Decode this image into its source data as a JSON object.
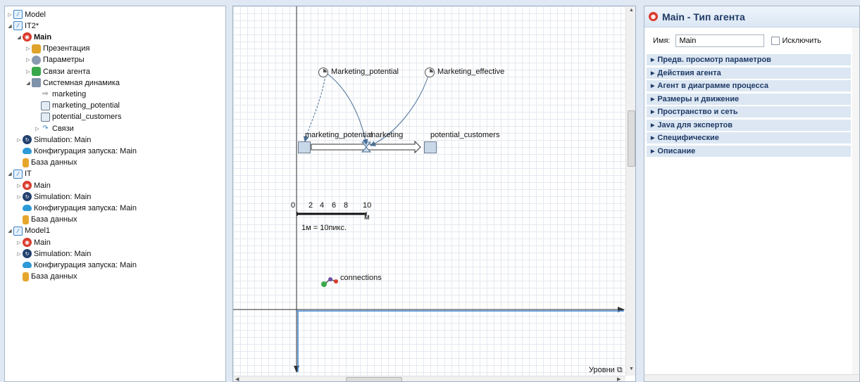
{
  "tree": [
    {
      "depth": 0,
      "arrow": "▷",
      "icon": "model",
      "label": "Model"
    },
    {
      "depth": 0,
      "arrow": "◢",
      "icon": "model",
      "label": "IT2*"
    },
    {
      "depth": 1,
      "arrow": "◢",
      "icon": "main",
      "label": "Main",
      "bold": true
    },
    {
      "depth": 2,
      "arrow": "▷",
      "icon": "pres",
      "label": "Презентация"
    },
    {
      "depth": 2,
      "arrow": "▷",
      "icon": "param",
      "label": "Параметры"
    },
    {
      "depth": 2,
      "arrow": "▷",
      "icon": "links",
      "label": "Связи агента"
    },
    {
      "depth": 2,
      "arrow": "◢",
      "icon": "sd",
      "label": "Системная динамика"
    },
    {
      "depth": 3,
      "arrow": "",
      "icon": "flow",
      "label": "marketing"
    },
    {
      "depth": 3,
      "arrow": "",
      "icon": "stock",
      "label": "marketing_potential"
    },
    {
      "depth": 3,
      "arrow": "",
      "icon": "stock",
      "label": "potential_customers"
    },
    {
      "depth": 3,
      "arrow": "▷",
      "icon": "conn",
      "label": "Связи"
    },
    {
      "depth": 1,
      "arrow": "▷",
      "icon": "sim",
      "label": "Simulation: Main"
    },
    {
      "depth": 1,
      "arrow": "",
      "icon": "cloud",
      "label": "Конфигурация запуска: Main"
    },
    {
      "depth": 1,
      "arrow": "",
      "icon": "db",
      "label": "База данных"
    },
    {
      "depth": 0,
      "arrow": "◢",
      "icon": "model",
      "label": "IT"
    },
    {
      "depth": 1,
      "arrow": "▷",
      "icon": "main",
      "label": "Main"
    },
    {
      "depth": 1,
      "arrow": "▷",
      "icon": "sim",
      "label": "Simulation: Main"
    },
    {
      "depth": 1,
      "arrow": "",
      "icon": "cloud",
      "label": "Конфигурация запуска: Main"
    },
    {
      "depth": 1,
      "arrow": "",
      "icon": "db",
      "label": "База данных"
    },
    {
      "depth": 0,
      "arrow": "◢",
      "icon": "model",
      "label": "Model1"
    },
    {
      "depth": 1,
      "arrow": "▷",
      "icon": "main",
      "label": "Main"
    },
    {
      "depth": 1,
      "arrow": "▷",
      "icon": "sim",
      "label": "Simulation: Main"
    },
    {
      "depth": 1,
      "arrow": "",
      "icon": "cloud",
      "label": "Конфигурация запуска: Main"
    },
    {
      "depth": 1,
      "arrow": "",
      "icon": "db",
      "label": "База данных"
    }
  ],
  "canvas": {
    "param_marketing_potential": "Marketing_potential",
    "param_marketing_effective": "Marketing_effective",
    "stock_marketing_potential": "marketing_potential",
    "flow_marketing": "marketing",
    "stock_potential_customers": "potential_customers",
    "scale_ticks": [
      "0",
      "2",
      "4",
      "6",
      "8",
      "10"
    ],
    "scale_unit": "м",
    "scale_caption": "1м = 10пикс.",
    "connections_label": "connections",
    "levels_button": "Уровни"
  },
  "properties": {
    "title": "Main - Тип агента",
    "name_label": "Имя:",
    "name_value": "Main",
    "exclude_label": "Исключить",
    "sections": [
      "Предв. просмотр параметров",
      "Действия агента",
      "Агент в диаграмме процесса",
      "Размеры и движение",
      "Пространство и сеть",
      "Java для экспертов",
      "Специфические",
      "Описание"
    ]
  }
}
